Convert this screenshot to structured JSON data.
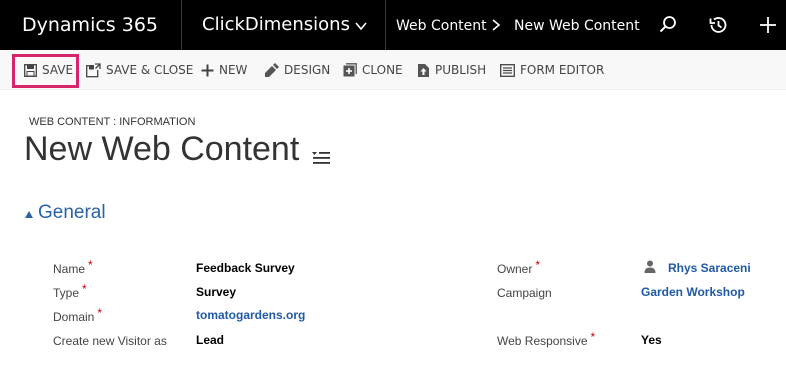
{
  "topbar": {
    "brand": "Dynamics 365",
    "app": "ClickDimensions",
    "breadcrumb": [
      "Web Content",
      "New Web Content"
    ],
    "icons": [
      "search-icon",
      "recent-icon",
      "new-icon"
    ]
  },
  "commands": {
    "save": "SAVE",
    "save_close": "SAVE & CLOSE",
    "new": "NEW",
    "design": "DESIGN",
    "clone": "CLONE",
    "publish": "PUBLISH",
    "form_editor": "FORM EDITOR"
  },
  "header": {
    "entity_type": "WEB CONTENT : INFORMATION",
    "title": "New Web Content"
  },
  "section": {
    "title": "General"
  },
  "fields": {
    "name": {
      "label": "Name",
      "required": "*",
      "value": "Feedback Survey"
    },
    "type": {
      "label": "Type",
      "required": "*",
      "value": "Survey"
    },
    "domain": {
      "label": "Domain",
      "required": "*",
      "value": "tomatogardens.org"
    },
    "create_visitor": {
      "label": "Create new Visitor as",
      "value": "Lead"
    },
    "owner": {
      "label": "Owner",
      "required": "*",
      "value": "Rhys Saraceni"
    },
    "campaign": {
      "label": "Campaign",
      "value": "Garden Workshop"
    },
    "web_responsive": {
      "label": "Web Responsive",
      "required": "*",
      "value": "Yes"
    }
  },
  "colors": {
    "topbar_bg": "#000000",
    "highlight": "#d6256b",
    "link": "#1e5aa6",
    "section": "#2b62a4",
    "required": "#cc0000"
  }
}
